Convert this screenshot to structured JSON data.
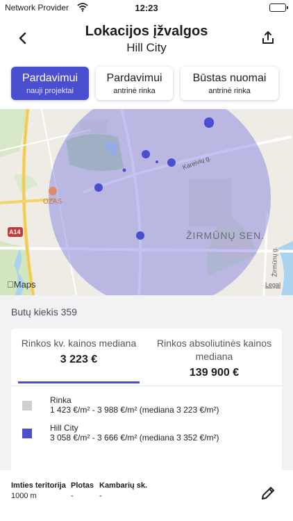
{
  "status_bar": {
    "provider": "Network Provider",
    "time": "12:23"
  },
  "header": {
    "title": "Lokacijos įžvalgos",
    "subtitle": "Hill City",
    "back_icon": "chevron-left-icon",
    "share_icon": "share-icon"
  },
  "tabs": [
    {
      "title": "Pardavimui",
      "subtitle": "nauji projektai",
      "active": true
    },
    {
      "title": "Pardavimui",
      "subtitle": "antrinė rinka",
      "active": false
    },
    {
      "title": "Būstas nuomai",
      "subtitle": "antrinė rinka",
      "active": false
    }
  ],
  "map": {
    "attribution": "Maps",
    "legal": "Legal",
    "road_badge": "A14",
    "poi_label": "OZAS",
    "street_label": "Kareivių g.",
    "district_label": "ŽIRMŪNŲ SEN.",
    "street2_label": "Žirmūnų g.",
    "radius_color": "#7b7be0",
    "marker_color": "#4a4fd0"
  },
  "summary": {
    "count": "Butų kiekis 359",
    "metric_tabs": [
      {
        "label": "Rinkos kv. kainos mediana",
        "value": "3 223 €",
        "active": true
      },
      {
        "label": "Rinkos absoliutinės kainos mediana",
        "value": "139 900 €",
        "active": false
      }
    ],
    "legend": [
      {
        "name": "Rinka",
        "range": "1 423 €/m² - 3 988 €/m² (mediana 3 223 €/m²)",
        "color": "#d0d0d0"
      },
      {
        "name": "Hill City",
        "range": "3 058 €/m² - 3 666 €/m² (mediana 3 352 €/m²)",
        "color": "#4a4fd0"
      }
    ]
  },
  "filters": [
    {
      "label": "Imties teritorija",
      "value": "1000 m"
    },
    {
      "label": "Plotas",
      "value": "-"
    },
    {
      "label": "Kambarių sk.",
      "value": "-"
    }
  ],
  "edit_icon": "pencil-icon"
}
